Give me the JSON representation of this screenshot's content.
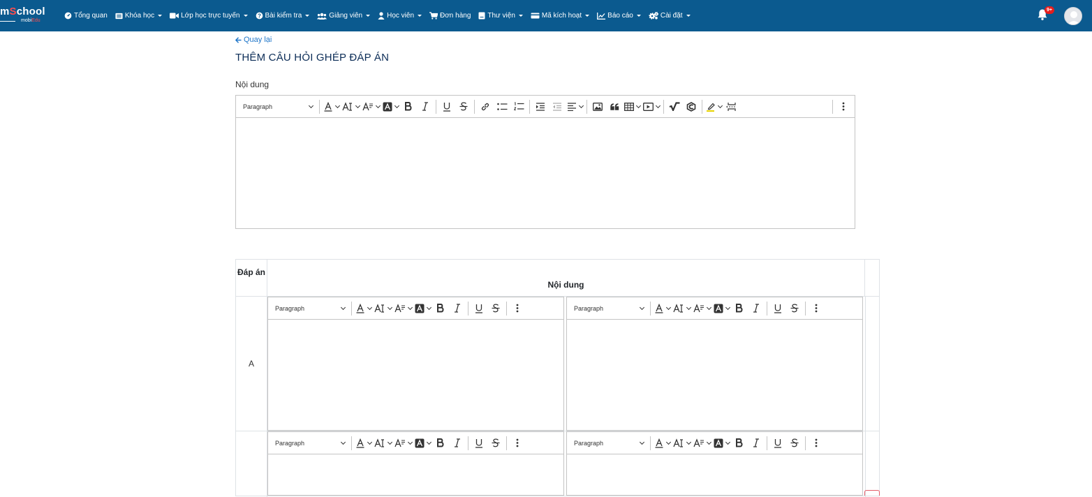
{
  "brand": {
    "logo_main_a": "m",
    "logo_main_s": "S",
    "logo_main_b": "chool",
    "logo_sub_a": "mobi",
    "logo_sub_b": "Edu"
  },
  "nav": {
    "items": [
      {
        "label": "Tổng quan",
        "icon": "dashboard-icon",
        "dropdown": false
      },
      {
        "label": "Khóa học",
        "icon": "book-icon",
        "dropdown": true
      },
      {
        "label": "Lớp học trực tuyến",
        "icon": "video-icon",
        "dropdown": true
      },
      {
        "label": "Bài kiểm tra",
        "icon": "question-circle-icon",
        "dropdown": true
      },
      {
        "label": "Giảng viên",
        "icon": "users-icon",
        "dropdown": true
      },
      {
        "label": "Học viên",
        "icon": "user-icon",
        "dropdown": true
      },
      {
        "label": "Đơn hàng",
        "icon": "cart-icon",
        "dropdown": false
      },
      {
        "label": "Thư viện",
        "icon": "library-icon",
        "dropdown": true
      },
      {
        "label": "Mã kích hoạt",
        "icon": "card-icon",
        "dropdown": true
      },
      {
        "label": "Báo cáo",
        "icon": "chart-icon",
        "dropdown": true
      },
      {
        "label": "Cài đặt",
        "icon": "cogs-icon",
        "dropdown": true
      }
    ],
    "notification_badge": "9+"
  },
  "page": {
    "back_label": "Quay lại",
    "title": "THÊM CÂU HỎI GHÉP ĐÁP ÁN",
    "content_label": "Nội dung"
  },
  "editor": {
    "paragraph_label": "Paragraph"
  },
  "answers_table": {
    "header_answer": "Đáp án",
    "header_content": "Nội dung",
    "rows": [
      {
        "label": "A"
      },
      {
        "label": ""
      }
    ]
  },
  "colors": {
    "nav_bg": "#0b5a8f",
    "title": "#0c2d57",
    "link": "#1f76c9",
    "badge": "#e51d1d"
  }
}
